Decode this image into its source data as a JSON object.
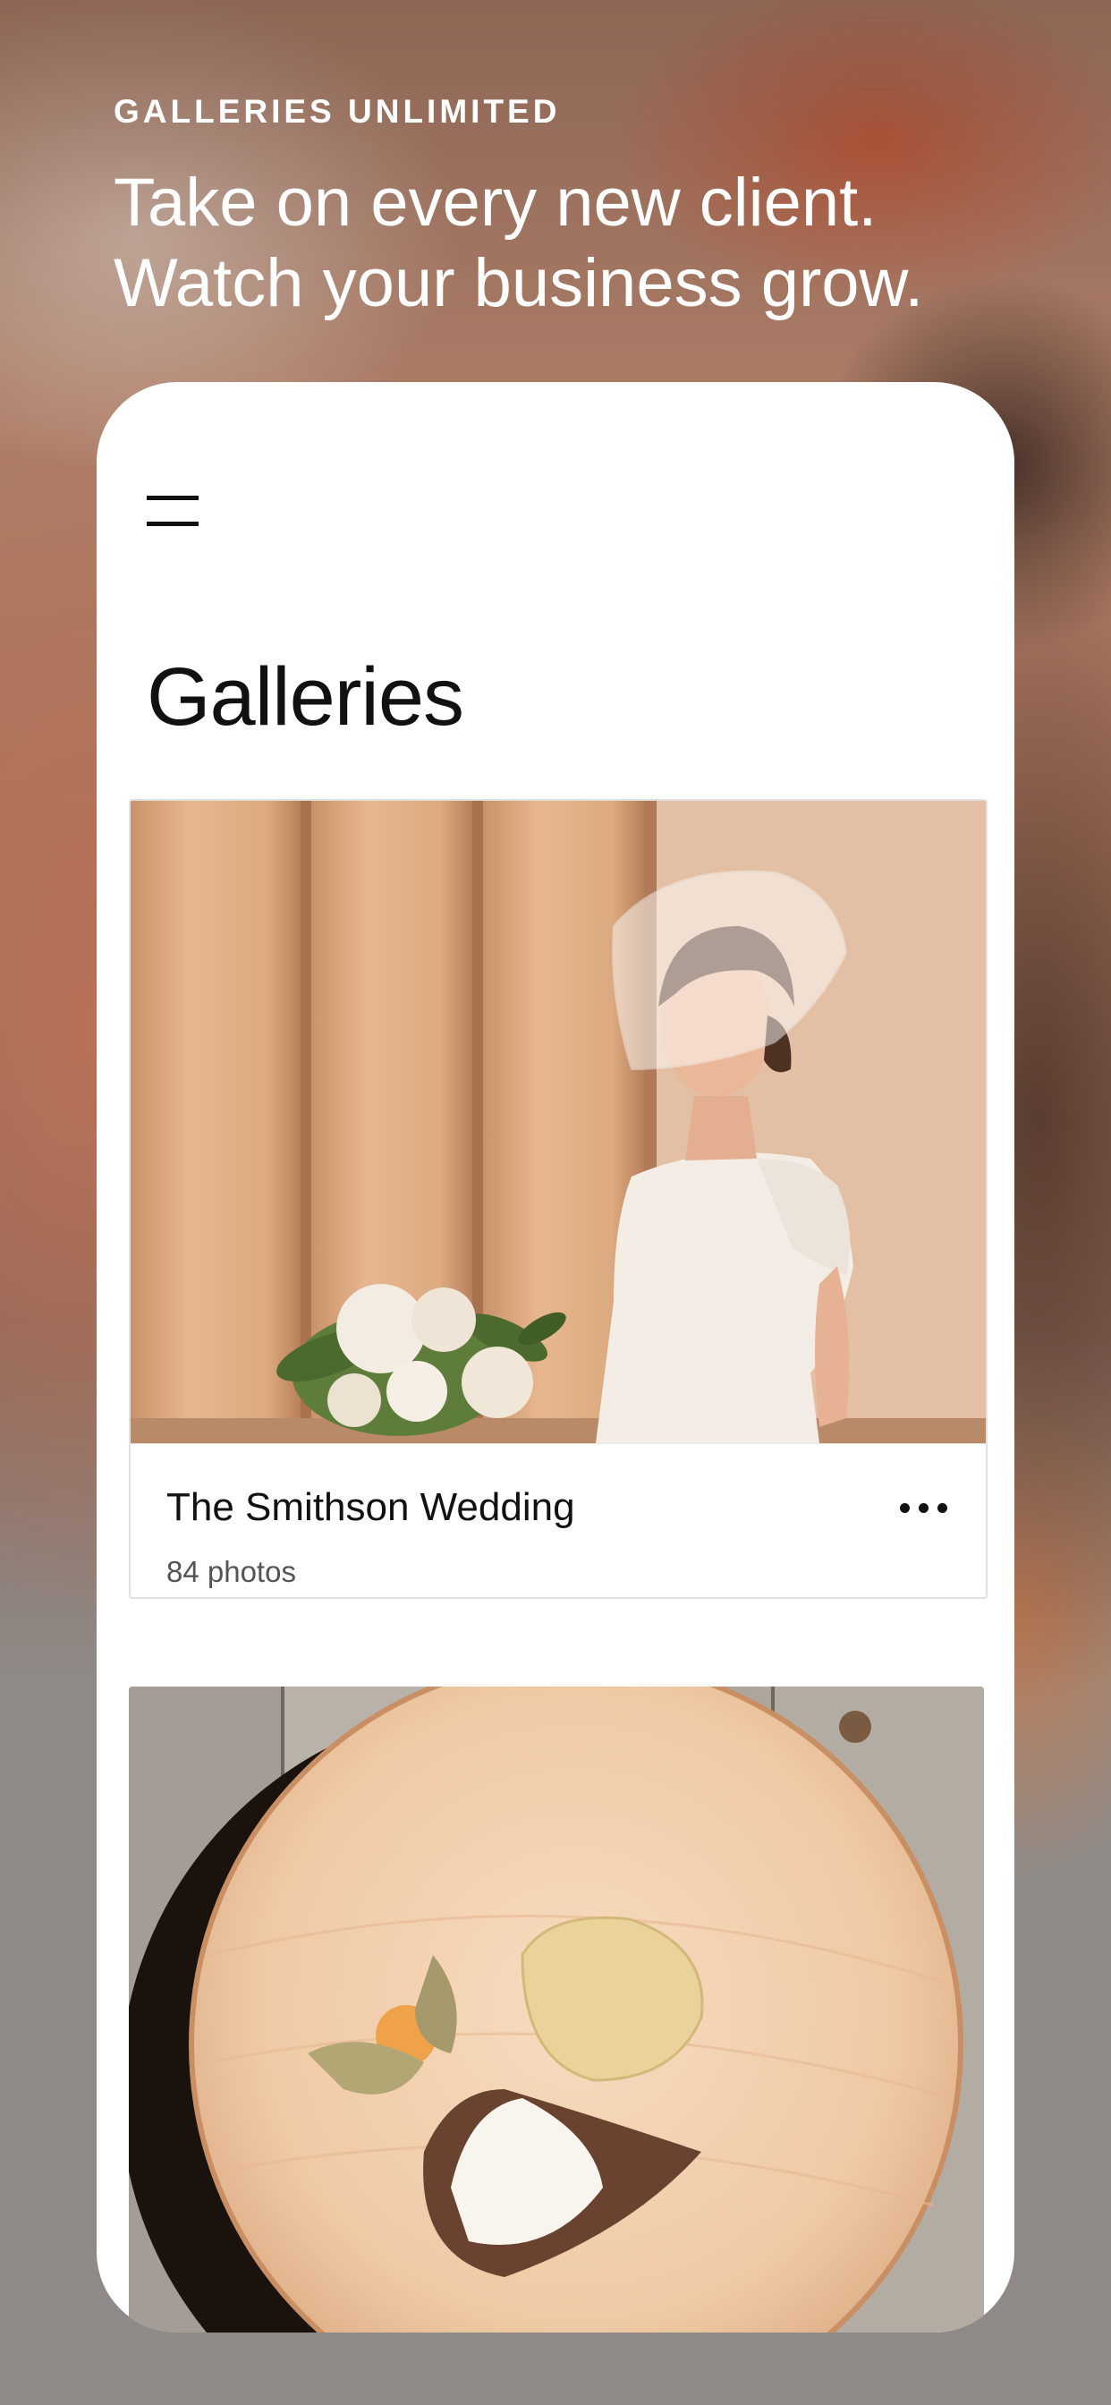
{
  "promo": {
    "brand": "GALLERIES UNLIMITED",
    "tagline_line1": "Take on every new client.",
    "tagline_line2": "Watch your business grow."
  },
  "app": {
    "menu_icon": "hamburger-menu-icon",
    "page_title": "Galleries",
    "galleries": [
      {
        "name": "The Smithson Wedding",
        "count": "84 photos",
        "photo": "bride-with-veil-and-bouquet",
        "more_icon": "more-horizontal-icon"
      },
      {
        "photo": "food-on-wooden-plate"
      }
    ]
  },
  "colors": {
    "card_background": "#ffffff",
    "text_primary": "#111111",
    "text_secondary": "#555555",
    "backdrop_gray": "#8f8a87"
  }
}
